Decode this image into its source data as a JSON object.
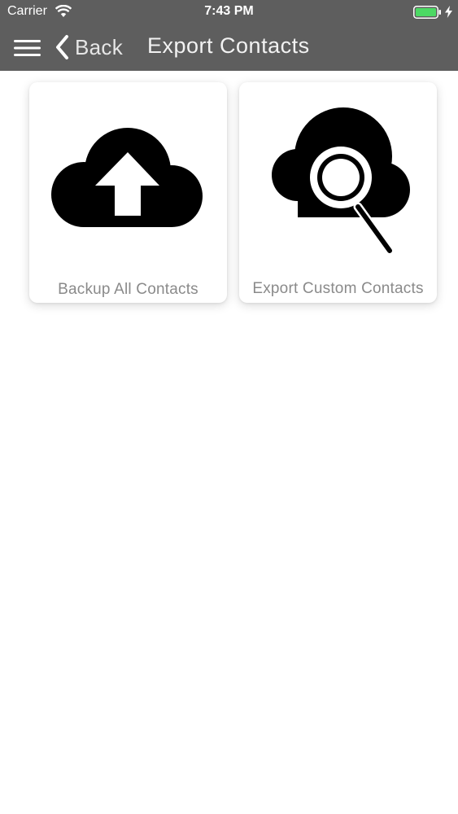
{
  "status_bar": {
    "carrier": "Carrier",
    "time": "7:43 PM",
    "icons": [
      "wifi-icon",
      "battery-icon",
      "charging-bolt-icon"
    ],
    "battery_color": "#4cd964"
  },
  "nav": {
    "back_label": "Back",
    "title": "Export Contacts",
    "icons": [
      "menu-icon",
      "chevron-left-icon"
    ],
    "background": "#5e5e5e"
  },
  "cards": [
    {
      "label": "Backup All Contacts",
      "icon": "cloud-upload-icon"
    },
    {
      "label": "Export Custom Contacts",
      "icon": "cloud-search-icon"
    }
  ]
}
